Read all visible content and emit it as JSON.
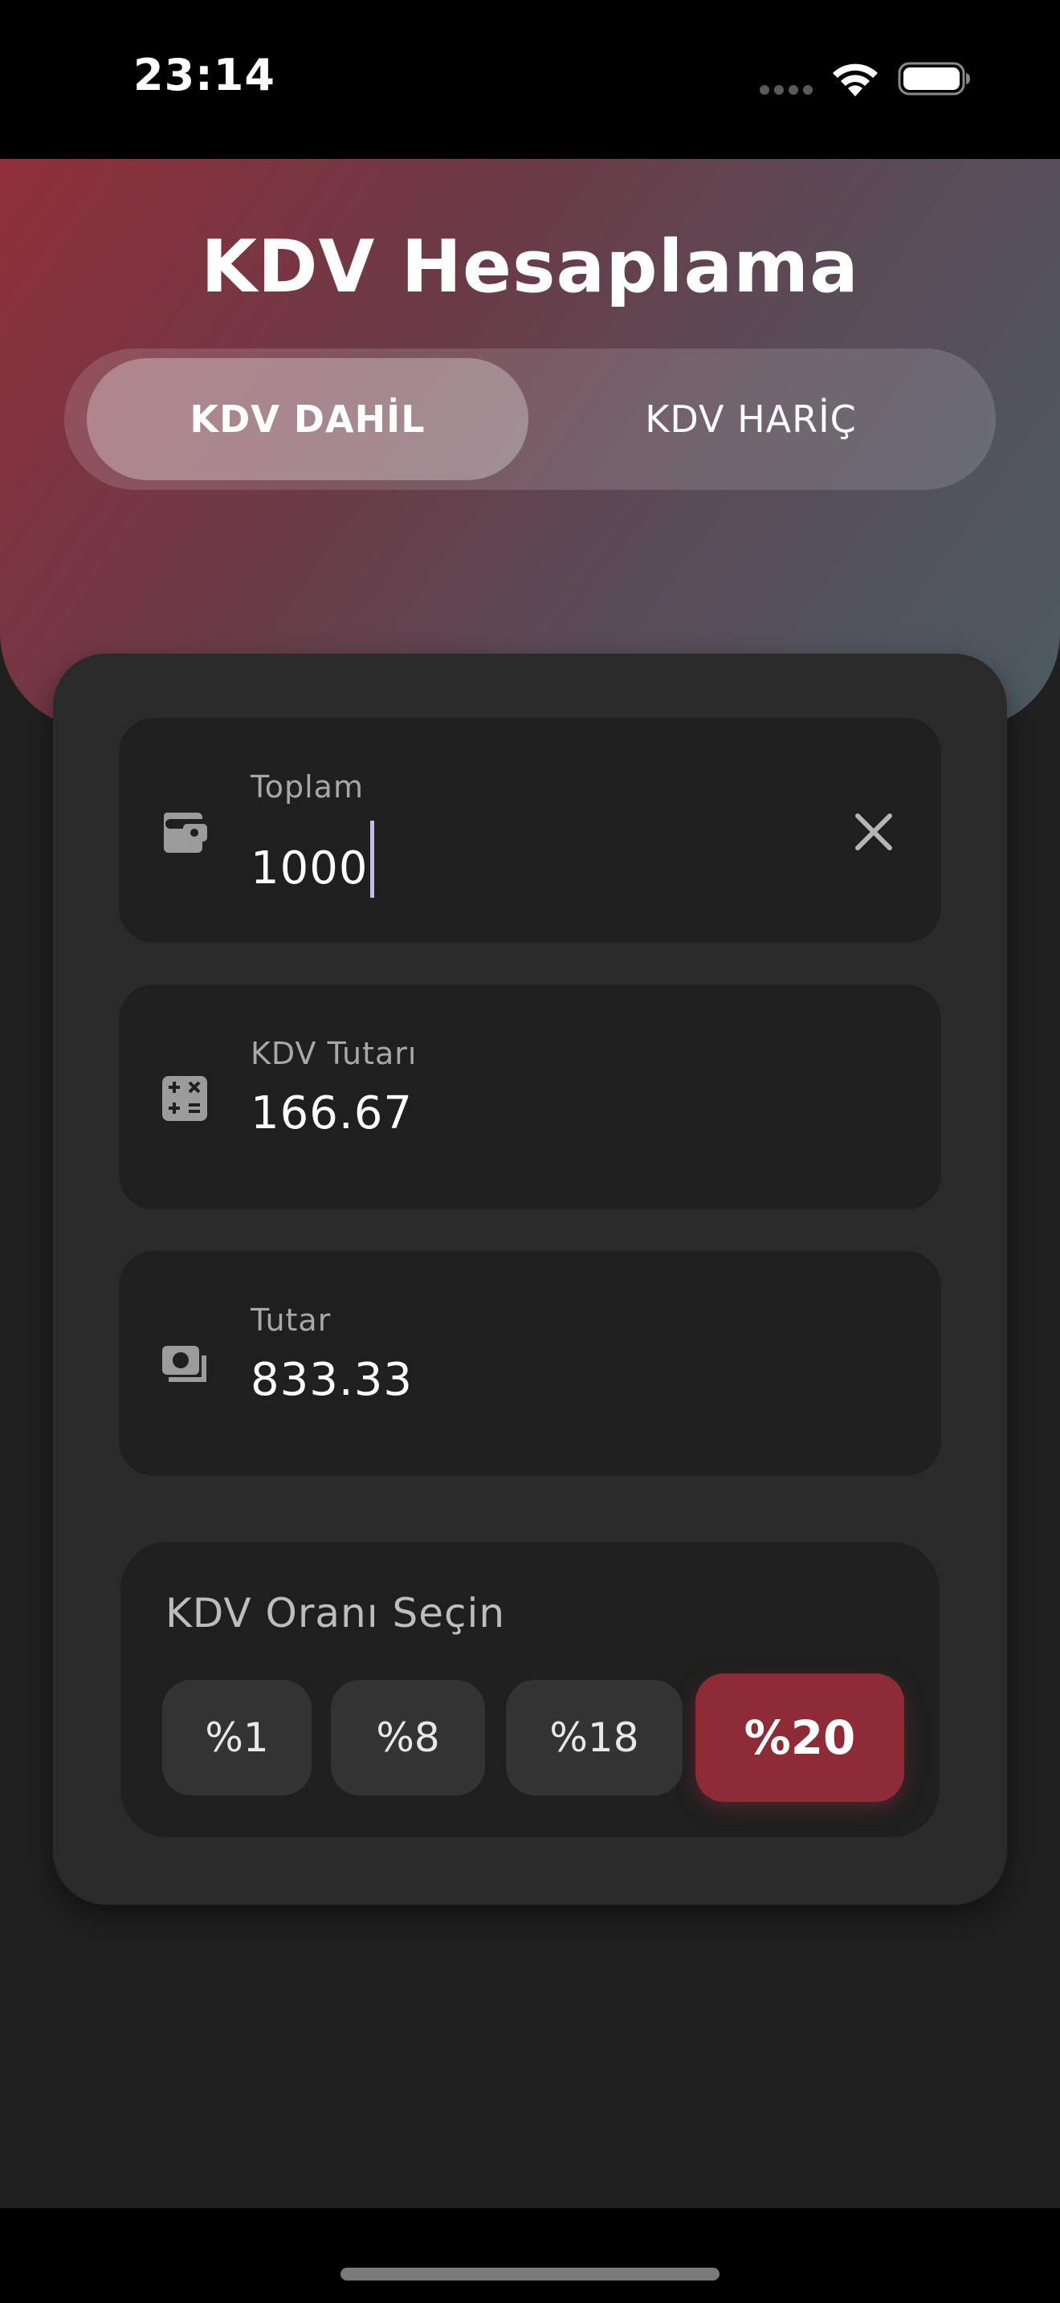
{
  "status_bar": {
    "time": "23:14"
  },
  "header": {
    "title": "KDV Hesaplama",
    "gradient_colors": [
      "#8f2f39",
      "#6a3b47",
      "#5a4b56",
      "#4c5b63"
    ]
  },
  "mode_toggle": {
    "tabs": [
      {
        "label": "KDV DAHİL",
        "selected": true
      },
      {
        "label": "KDV HARİÇ",
        "selected": false
      }
    ]
  },
  "fields": {
    "total": {
      "label": "Toplam",
      "value": "1000",
      "icon": "wallet-icon"
    },
    "vat_amount": {
      "label": "KDV Tutarı",
      "value": "166.67",
      "icon": "calculator-icon"
    },
    "net_amount": {
      "label": "Tutar",
      "value": "833.33",
      "icon": "money-icon"
    }
  },
  "rate_selector": {
    "title": "KDV Oranı Seçin",
    "options": [
      "%1",
      "%8",
      "%18",
      "%20"
    ],
    "selected": "%20",
    "accent_color": "#8d2c36"
  }
}
